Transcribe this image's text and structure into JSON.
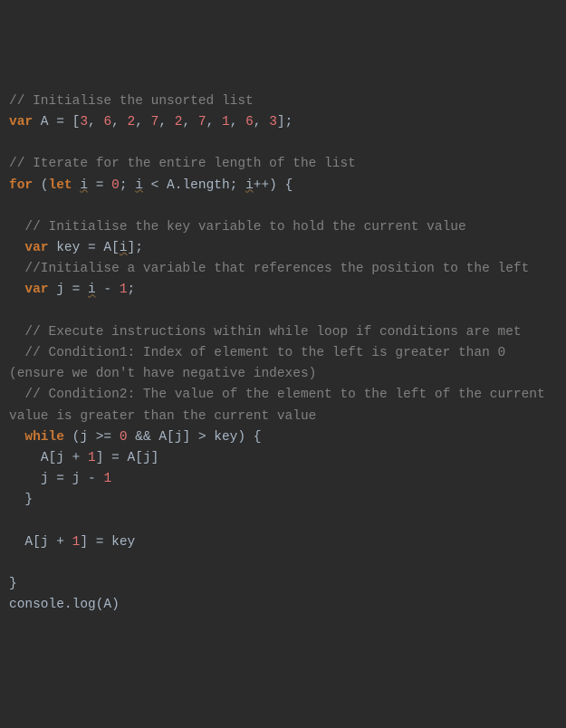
{
  "lines": {
    "c1": "// Initialise the unsorted list",
    "l1_var": "var",
    "l1_A": " A ",
    "l1_eq": "= [",
    "l1_n1": "3",
    "l1_c": ", ",
    "l1_n2": "6",
    "l1_n3": "2",
    "l1_n4": "7",
    "l1_n5": "2",
    "l1_n6": "7",
    "l1_n7": "1",
    "l1_n8": "6",
    "l1_n9": "3",
    "l1_end": "];",
    "c2": "// Iterate for the entire length of the list",
    "l2_for": "for",
    "l2_open": " (",
    "l2_let": "let",
    "l2_sp1": " ",
    "l2_i1": "i",
    "l2_eq": " = ",
    "l2_zero": "0",
    "l2_sc1": "; ",
    "l2_i2": "i",
    "l2_lt": " < A.length; ",
    "l2_i3": "i",
    "l2_pp": "++) {",
    "c3": "  // Initialise the key variable to hold the current value",
    "l3_indent": "  ",
    "l3_var": "var",
    "l3_key": " key = A[",
    "l3_i": "i",
    "l3_end": "];",
    "c4": "  //Initialise a variable that references the position to the left",
    "l4_indent": "  ",
    "l4_var": "var",
    "l4_j": " j = ",
    "l4_i": "i",
    "l4_minus": " - ",
    "l4_one": "1",
    "l4_sc": ";",
    "c5": "  // Execute instructions within while loop if conditions are met",
    "c6": "  // Condition1: Index of element to the left is greater than 0 (ensure we don't have negative indexes)",
    "c7": "  // Condition2: The value of the element to the left of the current value is greater than the current value",
    "l5_indent": "  ",
    "l5_while": "while",
    "l5_rest1": " (j >= ",
    "l5_zero": "0",
    "l5_rest2": " && A[j] > key) {",
    "l6_indent": "    A[j + ",
    "l6_one": "1",
    "l6_rest": "] = A[j]",
    "l7_indent": "    j = j - ",
    "l7_one": "1",
    "l8": "  }",
    "l9_indent": "  A[j + ",
    "l9_one": "1",
    "l9_rest": "] = key",
    "l10": "}",
    "l11": "console.log(A)"
  }
}
